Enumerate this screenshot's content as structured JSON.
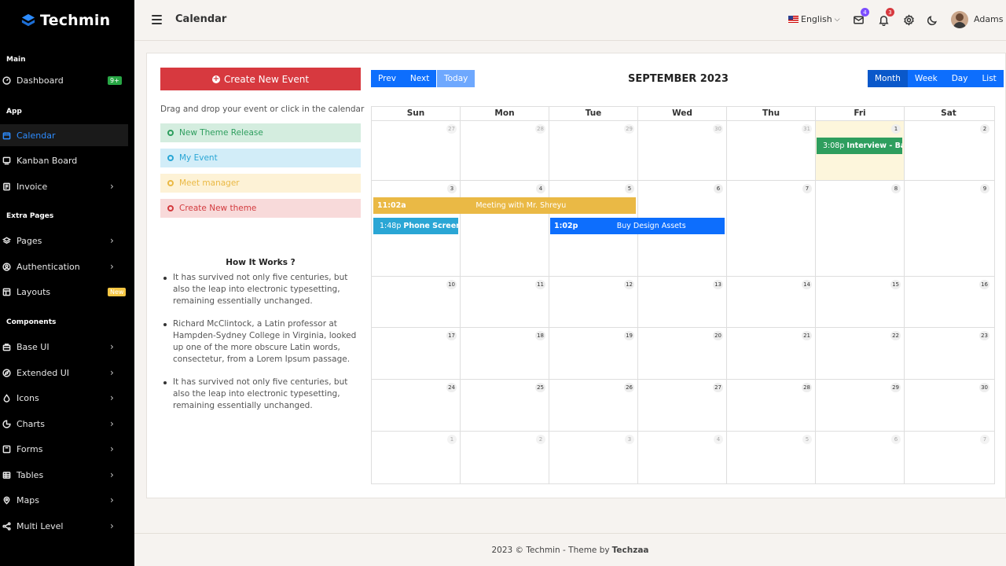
{
  "sidebar": {
    "brand": "Techmin",
    "sections": [
      {
        "title": "Main",
        "items": [
          {
            "label": "Dashboard",
            "icon": "gauge-icon",
            "badge": "9+",
            "badge_color": "green"
          }
        ]
      },
      {
        "title": "App",
        "items": [
          {
            "label": "Calendar",
            "icon": "calendar-icon",
            "active": true
          },
          {
            "label": "Kanban Board",
            "icon": "board-icon"
          },
          {
            "label": "Invoice",
            "icon": "invoice-icon",
            "chevron": true
          }
        ]
      },
      {
        "title": "Extra Pages",
        "items": [
          {
            "label": "Pages",
            "icon": "layers-icon",
            "chevron": true
          },
          {
            "label": "Authentication",
            "icon": "user-circle-icon",
            "chevron": true
          },
          {
            "label": "Layouts",
            "icon": "layout-icon",
            "badge": "New",
            "badge_color": "yellow"
          }
        ]
      },
      {
        "title": "Components",
        "items": [
          {
            "label": "Base UI",
            "icon": "briefcase-icon",
            "chevron": true
          },
          {
            "label": "Extended UI",
            "icon": "compass-icon",
            "chevron": true
          },
          {
            "label": "Icons",
            "icon": "drop-icon",
            "chevron": true
          },
          {
            "label": "Charts",
            "icon": "pie-icon",
            "chevron": true
          },
          {
            "label": "Forms",
            "icon": "form-icon",
            "chevron": true
          },
          {
            "label": "Tables",
            "icon": "table-icon",
            "chevron": true
          },
          {
            "label": "Maps",
            "icon": "pin-icon",
            "chevron": true
          },
          {
            "label": "Multi Level",
            "icon": "share-icon",
            "chevron": true
          }
        ]
      }
    ]
  },
  "topbar": {
    "title": "Calendar",
    "language": "English",
    "mail_count": "4",
    "notification_count": "3",
    "username": "Adams"
  },
  "left_panel": {
    "create_button": "Create New Event",
    "drag_hint": "Drag and drop your event or click in the calendar",
    "external_events": [
      {
        "label": "New Theme Release",
        "bg": "#d4eddf",
        "fg": "#2e9e5e"
      },
      {
        "label": "My Event",
        "bg": "#d2edf8",
        "fg": "#2aa6d5"
      },
      {
        "label": "Meet manager",
        "bg": "#fdf2d6",
        "fg": "#eab945"
      },
      {
        "label": "Create New theme",
        "bg": "#f8dada",
        "fg": "#d33b3f"
      }
    ],
    "how_title": "How It Works ?",
    "how_items": [
      "It has survived not only five centuries, but also the leap into electronic typesetting, remaining essentially unchanged.",
      "Richard McClintock, a Latin professor at Hampden-Sydney College in Virginia, looked up one of the more obscure Latin words, consectetur, from a Lorem Ipsum passage.",
      "It has survived not only five centuries, but also the leap into electronic typesetting, remaining essentially unchanged."
    ]
  },
  "calendar": {
    "title": "SEPTEMBER 2023",
    "nav": {
      "prev": "Prev",
      "next": "Next",
      "today": "Today"
    },
    "views": {
      "month": "Month",
      "week": "Week",
      "day": "Day",
      "list": "List",
      "active": "Month"
    },
    "weekdays": [
      "Sun",
      "Mon",
      "Tue",
      "Wed",
      "Thu",
      "Fri",
      "Sat"
    ],
    "weeks": [
      [
        {
          "d": "27",
          "o": true
        },
        {
          "d": "28",
          "o": true
        },
        {
          "d": "29",
          "o": true
        },
        {
          "d": "30",
          "o": true
        },
        {
          "d": "31",
          "o": true
        },
        {
          "d": "1",
          "t": true
        },
        {
          "d": "2"
        }
      ],
      [
        {
          "d": "3"
        },
        {
          "d": "4"
        },
        {
          "d": "5"
        },
        {
          "d": "6"
        },
        {
          "d": "7"
        },
        {
          "d": "8"
        },
        {
          "d": "9"
        }
      ],
      [
        {
          "d": "10"
        },
        {
          "d": "11"
        },
        {
          "d": "12"
        },
        {
          "d": "13"
        },
        {
          "d": "14"
        },
        {
          "d": "15"
        },
        {
          "d": "16"
        }
      ],
      [
        {
          "d": "17"
        },
        {
          "d": "18"
        },
        {
          "d": "19"
        },
        {
          "d": "20"
        },
        {
          "d": "21"
        },
        {
          "d": "22"
        },
        {
          "d": "23"
        }
      ],
      [
        {
          "d": "24"
        },
        {
          "d": "25"
        },
        {
          "d": "26"
        },
        {
          "d": "27"
        },
        {
          "d": "28"
        },
        {
          "d": "29"
        },
        {
          "d": "30"
        }
      ],
      [
        {
          "d": "1",
          "o": true
        },
        {
          "d": "2",
          "o": true
        },
        {
          "d": "3",
          "o": true
        },
        {
          "d": "4",
          "o": true
        },
        {
          "d": "5",
          "o": true
        },
        {
          "d": "6",
          "o": true
        },
        {
          "d": "7",
          "o": true
        }
      ]
    ],
    "events": [
      {
        "week": 0,
        "start": 5,
        "span": 1,
        "lane": 0,
        "time": "3:08p",
        "title": "Interview - Backend Engineer",
        "color": "#2e9e5e",
        "style": "dot"
      },
      {
        "week": 1,
        "start": 0,
        "span": 3,
        "lane": 0,
        "time": "11:02a",
        "title": "Meeting with Mr. Shreyu",
        "color": "#eab945",
        "style": "block"
      },
      {
        "week": 1,
        "start": 0,
        "span": 1,
        "lane": 1,
        "time": "1:48p",
        "title": "Phone Screen - Frontend Engineer",
        "color": "#2aa6d5",
        "style": "dot"
      },
      {
        "week": 1,
        "start": 2,
        "span": 2,
        "lane": 1,
        "time": "1:02p",
        "title": "Buy Design Assets",
        "color": "#0d6efd",
        "style": "block"
      }
    ]
  },
  "footer": {
    "text": "2023 © Techmin - Theme by",
    "author": "Techzaa"
  },
  "colors": {
    "accent": "#0d6efd",
    "danger": "#d7393f",
    "sidebar_bg": "#000000"
  }
}
